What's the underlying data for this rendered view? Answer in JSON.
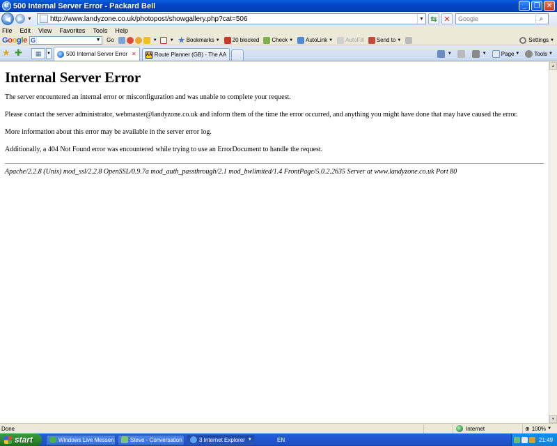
{
  "window": {
    "title": "500 Internal Server Error - Packard Bell"
  },
  "address_bar": {
    "url": "http://www.landyzone.co.uk/photopost/showgallery.php?cat=506",
    "search_placeholder": "Google"
  },
  "menu": [
    "File",
    "Edit",
    "View",
    "Favorites",
    "Tools",
    "Help"
  ],
  "google_toolbar": {
    "go_label": "Go",
    "bookmarks_label": "Bookmarks",
    "blocked_label": "20 blocked",
    "check_label": "Check",
    "autolink_label": "AutoLink",
    "autofill_label": "AutoFill",
    "sendto_label": "Send to",
    "settings_label": "Settings"
  },
  "tabs": [
    {
      "label": "500 Internal Server Error",
      "active": true
    },
    {
      "label": "Route Planner (GB) - The AA",
      "active": false
    }
  ],
  "command_bar": {
    "page_label": "Page",
    "tools_label": "Tools"
  },
  "content": {
    "heading": "Internal Server Error",
    "p1": "The server encountered an internal error or misconfiguration and was unable to complete your request.",
    "p2": "Please contact the server administrator, webmaster@landyzone.co.uk and inform them of the time the error occurred, and anything you might have done that may have caused the error.",
    "p3": "More information about this error may be available in the server error log.",
    "p4": "Additionally, a 404 Not Found error was encountered while trying to use an ErrorDocument to handle the request.",
    "address": "Apache/2.2.8 (Unix) mod_ssl/2.2.8 OpenSSL/0.9.7a mod_auth_passthrough/2.1 mod_bwlimited/1.4 FrontPage/5.0.2.2635 Server at www.landyzone.co.uk Port 80"
  },
  "status_bar": {
    "status": "Done",
    "zone": "Internet",
    "zoom": "100%"
  },
  "taskbar": {
    "start_label": "start",
    "tasks": [
      {
        "label": "Windows Live Messen...",
        "active": false
      },
      {
        "label": "Steve - Conversation",
        "active": false
      },
      {
        "label": "3 Internet Explorer",
        "active": true
      }
    ],
    "language": "EN",
    "clock": "21:49"
  }
}
